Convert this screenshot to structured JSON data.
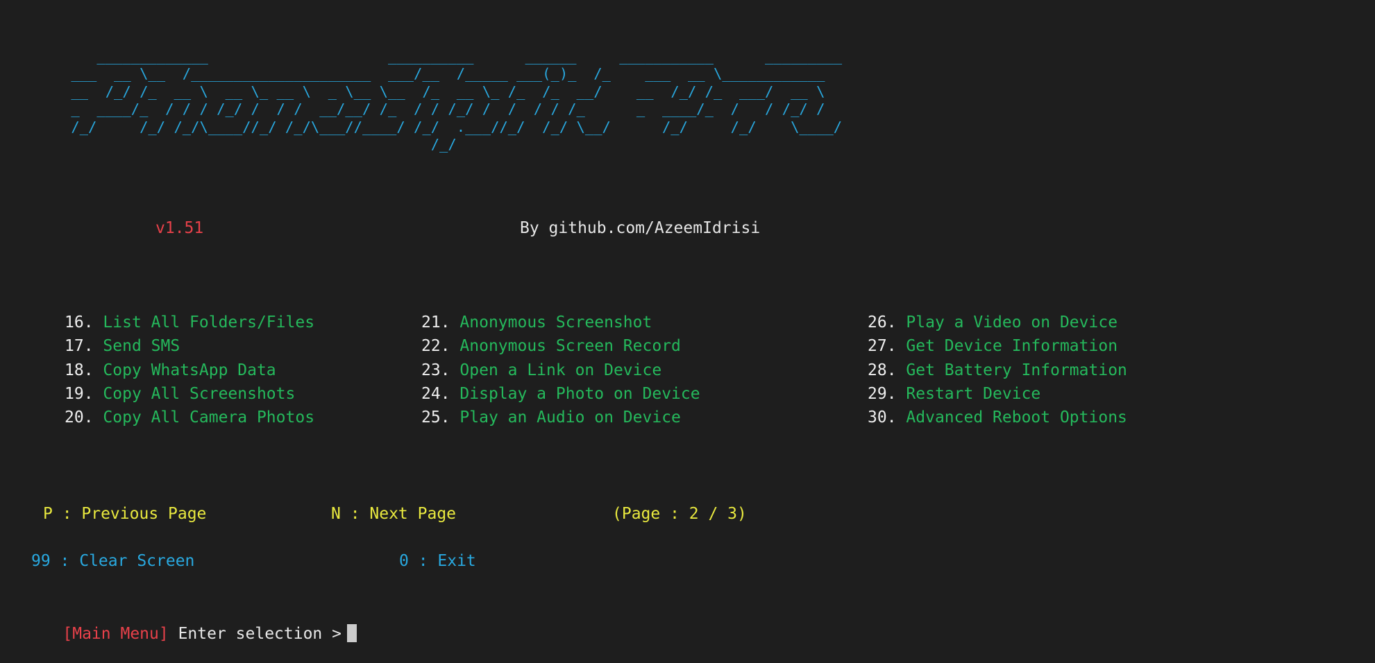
{
  "terminal": {
    "background_color": "#1e1e1e",
    "banner_color": "#29a9e0",
    "menu_number_color": "#efefef",
    "menu_label_color": "#25b95c",
    "nav_color": "#e9e93f",
    "util_color": "#29a9e0",
    "accent_red": "#e8414a",
    "cursor_color": "#cccccc"
  },
  "banner": {
    "name": "phonesploit-pro-ascii-logo",
    "art": "    _____________                     __________      ______     ___________      _________\n ___  __ \\__  /_____________________  ___/__  /_____ ___(_)_  /_    ___  __ \\____________\n __  /_/ /_  __ \\  __ \\_ __ \\  _ \\__ \\__  /_  __ \\_ /_  /_  __/    __  /_/ /_  ___/  __ \\\n _  ____/_  / / / /_/ /  / /  __/__/ /_  / / /_/ /  /  / / /_      _  ____/_  /   / /_/ /\n /_/     /_/ /_/\\____//_/ /_/\\___//____/ /_/  .___//_/  /_/ \\__/      /_/     /_/    \\____/\n                                           /_/"
  },
  "header": {
    "version": "v1.51",
    "author": "By github.com/AzeemIdrisi"
  },
  "menu": {
    "columns": [
      {
        "name": "menu-column-1",
        "items": [
          {
            "num": "16.",
            "label": "List All Folders/Files"
          },
          {
            "num": "17.",
            "label": "Send SMS"
          },
          {
            "num": "18.",
            "label": "Copy WhatsApp Data"
          },
          {
            "num": "19.",
            "label": "Copy All Screenshots"
          },
          {
            "num": "20.",
            "label": "Copy All Camera Photos"
          }
        ]
      },
      {
        "name": "menu-column-2",
        "items": [
          {
            "num": "21.",
            "label": "Anonymous Screenshot"
          },
          {
            "num": "22.",
            "label": "Anonymous Screen Record"
          },
          {
            "num": "23.",
            "label": "Open a Link on Device"
          },
          {
            "num": "24.",
            "label": "Display a Photo on Device"
          },
          {
            "num": "25.",
            "label": "Play an Audio on Device"
          }
        ]
      },
      {
        "name": "menu-column-3",
        "items": [
          {
            "num": "26.",
            "label": "Play a Video on Device"
          },
          {
            "num": "27.",
            "label": "Get Device Information"
          },
          {
            "num": "28.",
            "label": "Get Battery Information"
          },
          {
            "num": "29.",
            "label": "Restart Device"
          },
          {
            "num": "30.",
            "label": "Advanced Reboot Options"
          }
        ]
      }
    ]
  },
  "navigation": {
    "previous": "P : Previous Page",
    "next": "N : Next Page",
    "page_indicator": "(Page : 2 / 3)",
    "current_page": 2,
    "total_pages": 3
  },
  "utility": {
    "clear": "99 : Clear Screen",
    "exit": "0 : Exit"
  },
  "prompt": {
    "context": "[Main Menu]",
    "text": " Enter selection ",
    "arrow": ">",
    "input_value": ""
  }
}
